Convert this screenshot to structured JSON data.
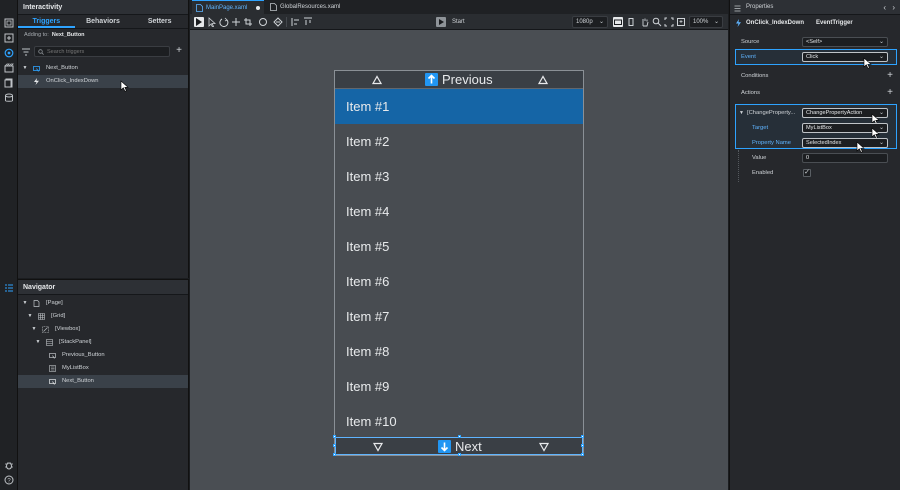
{
  "interactivity": {
    "title": "Interactivity",
    "tabs": [
      "Triggers",
      "Behaviors",
      "Setters"
    ],
    "adding_prefix": "Adding to:",
    "adding_target": "Next_Button",
    "search_placeholder": "Search triggers",
    "tree": [
      {
        "label": "Next_Button"
      },
      {
        "label": "OnClick_IndexDown"
      }
    ]
  },
  "navigator": {
    "title": "Navigator",
    "tree": [
      {
        "label": "[Page]"
      },
      {
        "label": "[Grid]"
      },
      {
        "label": "[Viewbox]"
      },
      {
        "label": "[StackPanel]"
      },
      {
        "label": "Previous_Button"
      },
      {
        "label": "MyListBox"
      },
      {
        "label": "Next_Button"
      }
    ]
  },
  "document": {
    "tabs": [
      {
        "label": "MainPage.xaml",
        "active": true
      },
      {
        "label": "GlobalResources.xaml",
        "active": false
      }
    ],
    "toolbar": {
      "start_label": "Start",
      "resolution": "1080p",
      "zoom": "100%"
    },
    "canvas": {
      "previous_label": "Previous",
      "next_label": "Next",
      "items": [
        "Item #1",
        "Item #2",
        "Item #3",
        "Item #4",
        "Item #5",
        "Item #6",
        "Item #7",
        "Item #8",
        "Item #9",
        "Item #10"
      ],
      "selected_index": 0
    }
  },
  "properties": {
    "title": "Properties",
    "trigger_name": "OnClick_IndexDown",
    "trigger_type": "EventTrigger",
    "source_label": "Source",
    "source_value": "<Self>",
    "event_label": "Event",
    "event_value": "Click",
    "conditions_label": "Conditions",
    "actions_label": "Actions",
    "action_label": "[ChangeProperty...",
    "action_value": "ChangePropertyAction",
    "target_label": "Target",
    "target_value": "MyListBox",
    "property_name_label": "Property Name",
    "property_name_value": "SelectedIndex",
    "value_label": "Value",
    "value_value": "0",
    "enabled_label": "Enabled",
    "enabled_checked": true
  },
  "colors": {
    "accent": "#2ea3ff",
    "selected_item": "#1565a6",
    "nav_arrow": "#2196f3"
  }
}
